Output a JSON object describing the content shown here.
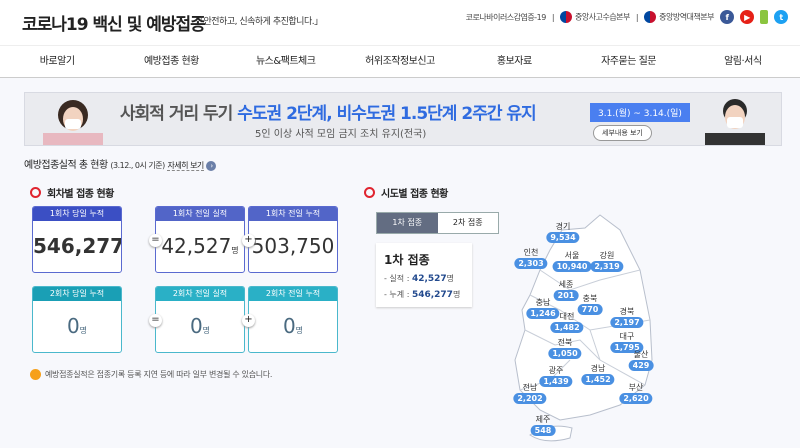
{
  "header": {
    "title": "코로나19 백신 및 예방접종",
    "slogan": "「안전하고, 신속하게 추진합니다.」",
    "links": [
      "코로나바이러스감염증-19",
      "중앙사고수습본부",
      "중앙방역대책본부"
    ],
    "sns": [
      "facebook",
      "youtube",
      "blog",
      "twitter"
    ]
  },
  "nav": [
    "바로알기",
    "예방접종 현황",
    "뉴스&팩트체크",
    "허위조작정보신고",
    "홍보자료",
    "자주묻는 질문",
    "알림·서식"
  ],
  "banner": {
    "lead": "사회적 거리 두기 ",
    "highlight": "수도권 2단계, 비수도권 1.5단계 2주간 유지",
    "date": "3.1.(월) ~ 3.14.(일)",
    "sub": "5인 이상 사적 모임 금지 조치 유지(전국)",
    "more": "세부내용 보기"
  },
  "summary": {
    "title": "예방접종실적 총 현황",
    "basis": "(3.12., 0시 기준)",
    "more": "자세히 보기"
  },
  "dose": {
    "title": "회차별 접종 현황",
    "unit": "명",
    "first": [
      {
        "label": "1회차 당일 누적",
        "value": "546,277"
      },
      {
        "label": "1회차 전일 실적",
        "value": "42,527"
      },
      {
        "label": "1회차 전일 누적",
        "value": "503,750"
      }
    ],
    "second": [
      {
        "label": "2회차 당일 누적",
        "value": "0"
      },
      {
        "label": "2회차 전일 실적",
        "value": "0"
      },
      {
        "label": "2회차 전일 누적",
        "value": "0"
      }
    ],
    "ops": [
      "=",
      "+"
    ],
    "note": "예방접종실적은 접종기록 등록 지연 등에 따라 일부 변경될 수 있습니다."
  },
  "region": {
    "title": "시도별 접종 현황",
    "tabs": [
      "1차 접종",
      "2차 접종"
    ],
    "info_title": "1차 접종",
    "perf_label": "- 실적 :",
    "perf": "42,527",
    "total_label": "- 누계 :",
    "total": "546,277",
    "items": [
      {
        "name": "경기",
        "value": "9,534"
      },
      {
        "name": "인천",
        "value": "2,303"
      },
      {
        "name": "서울",
        "value": "10,940"
      },
      {
        "name": "강원",
        "value": "2,319"
      },
      {
        "name": "세종",
        "value": "201"
      },
      {
        "name": "충북",
        "value": "770"
      },
      {
        "name": "충남",
        "value": "1,246"
      },
      {
        "name": "대전",
        "value": "1,482"
      },
      {
        "name": "경북",
        "value": "2,197"
      },
      {
        "name": "대구",
        "value": "1,795"
      },
      {
        "name": "전북",
        "value": "1,050"
      },
      {
        "name": "울산",
        "value": "429"
      },
      {
        "name": "광주",
        "value": "1,439"
      },
      {
        "name": "경남",
        "value": "1,452"
      },
      {
        "name": "전남",
        "value": "2,202"
      },
      {
        "name": "부산",
        "value": "2,620"
      },
      {
        "name": "제주",
        "value": "548"
      }
    ]
  },
  "colors": {
    "dose1_header": "#3b4fc4",
    "dose2_header": "#1aa5bd",
    "pill": "#4a90e2",
    "accent": "#2f6be0"
  }
}
